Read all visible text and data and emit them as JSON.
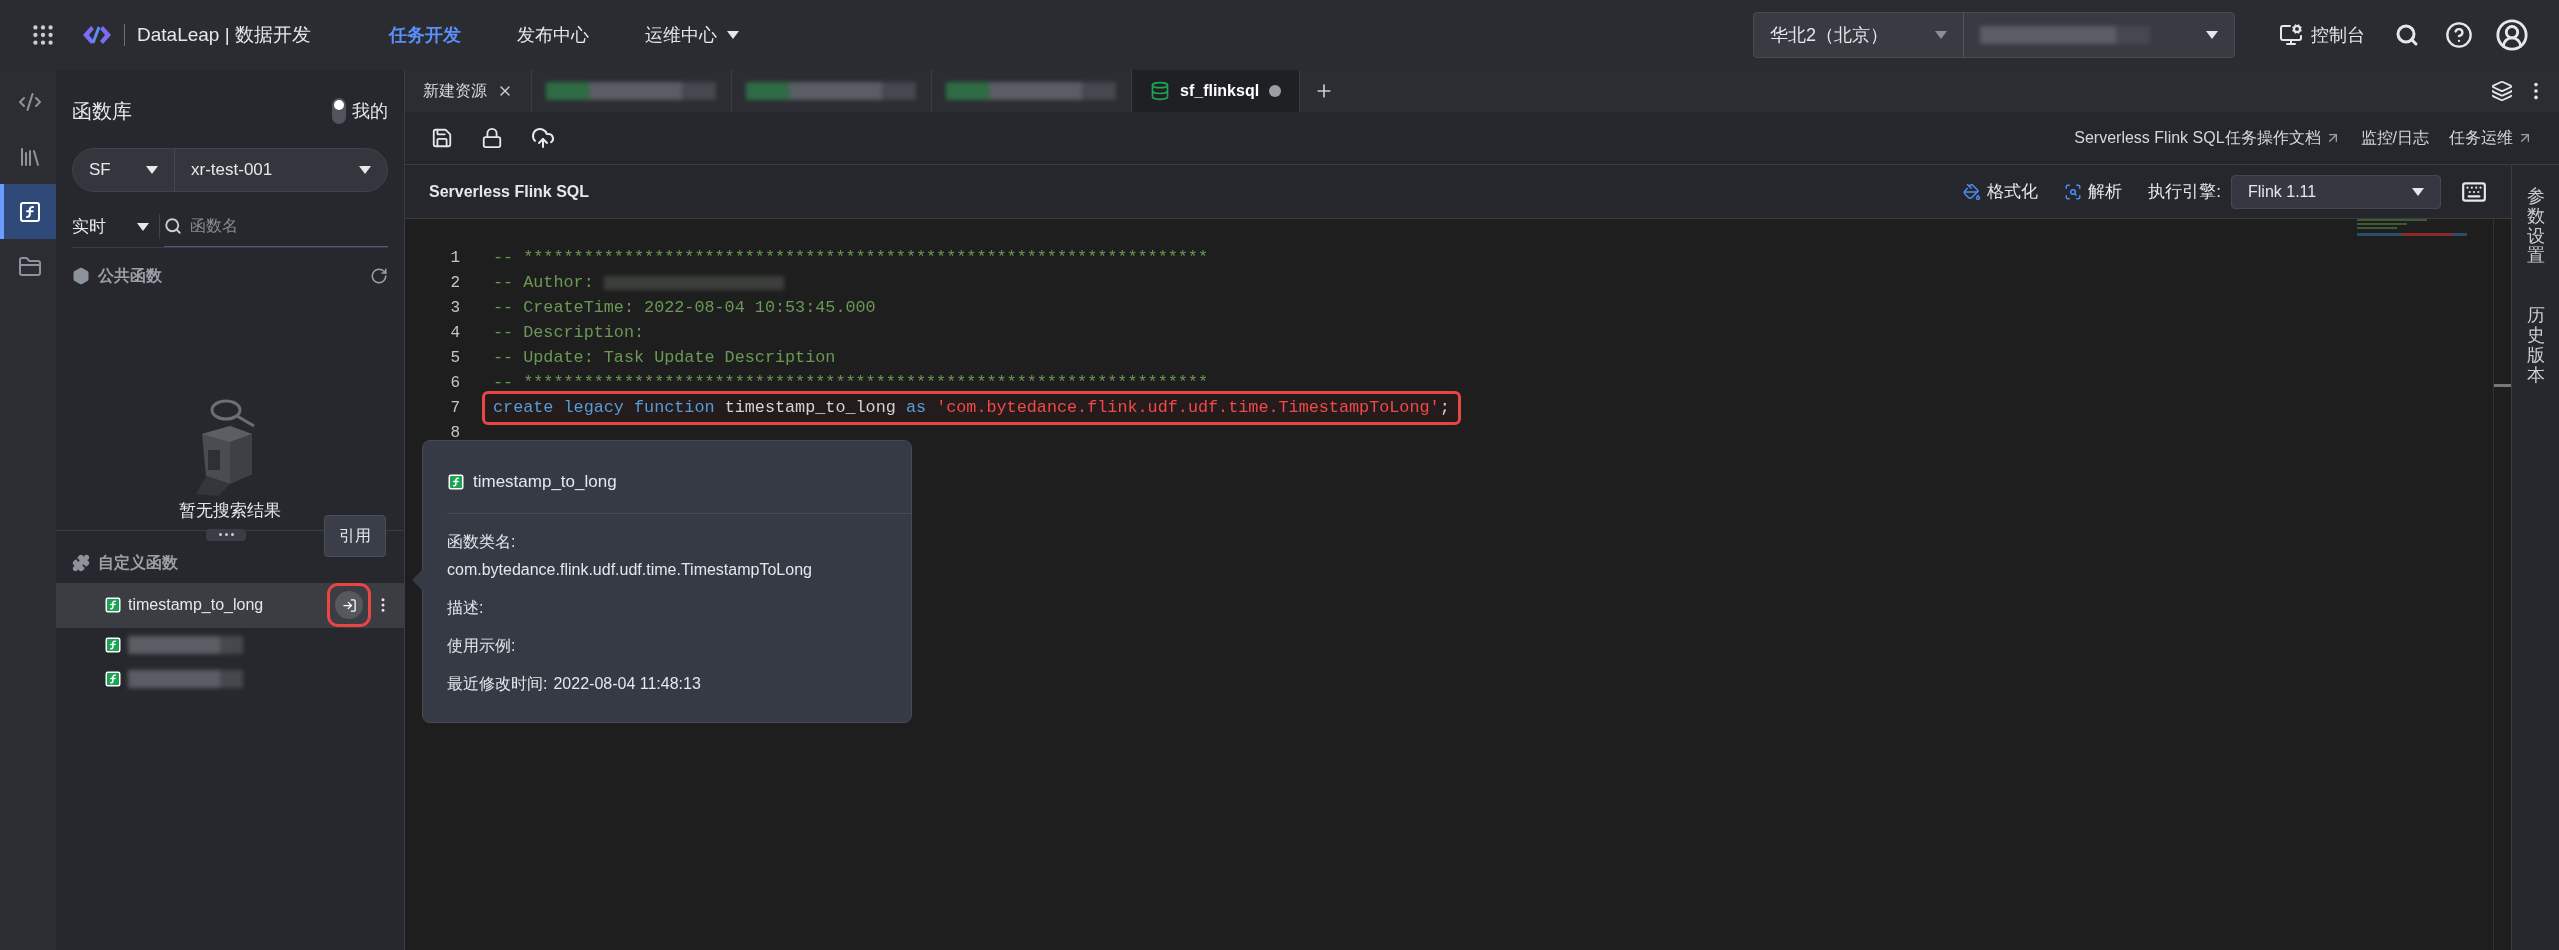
{
  "topbar": {
    "brand": "DataLeap | 数据开发",
    "nav": [
      {
        "label": "任务开发",
        "selected": true,
        "caret": false
      },
      {
        "label": "发布中心",
        "selected": false,
        "caret": false
      },
      {
        "label": "运维中心",
        "selected": false,
        "caret": true
      }
    ],
    "region": "华北2（北京）",
    "project": {
      "kind": "redacted"
    },
    "console": "控制台"
  },
  "rail": [
    {
      "kind": "code",
      "selected": false
    },
    {
      "kind": "library",
      "selected": false
    },
    {
      "kind": "function",
      "selected": true
    },
    {
      "kind": "drive",
      "selected": false
    }
  ],
  "panel": {
    "title": "函数库",
    "mine": {
      "label": "我的",
      "on": false
    },
    "engine": "SF",
    "project": "xr-test-001",
    "mode": "实时",
    "search_placeholder": "函数名",
    "public": {
      "title": "公共函数",
      "empty": "暂无搜索结果"
    },
    "custom": {
      "title": "自定义函数",
      "items": [
        {
          "kind": "named",
          "name": "timestamp_to_long",
          "selected": true
        },
        {
          "kind": "redacted",
          "selected": false
        },
        {
          "kind": "redacted",
          "selected": false
        }
      ]
    },
    "reference_tip": "引用"
  },
  "tabs": [
    {
      "kind": "named",
      "label": "新建资源",
      "selected": false,
      "closable": true
    },
    {
      "kind": "redacted",
      "selected": false
    },
    {
      "kind": "redacted",
      "selected": false
    },
    {
      "kind": "redacted",
      "selected": false
    },
    {
      "kind": "named",
      "label": "sf_flinksql",
      "selected": true,
      "closable": false
    }
  ],
  "links": [
    {
      "label": "Serverless Flink SQL任务操作文档",
      "external": true
    },
    {
      "label": "监控/日志",
      "external": false
    },
    {
      "label": "任务运维",
      "external": true
    }
  ],
  "editor": {
    "title": "Serverless Flink SQL",
    "format": "格式化",
    "parse": "解析",
    "engine_label": "执行引擎:",
    "engine": "Flink 1.11",
    "lines": [
      {
        "number": "1",
        "highlighted": false,
        "tokens": [
          {
            "kind": "comment",
            "text": "-- ********************************************************************"
          }
        ]
      },
      {
        "number": "2",
        "highlighted": false,
        "tokens": [
          {
            "kind": "comment",
            "text": "-- Author: "
          },
          {
            "kind": "redacted"
          }
        ]
      },
      {
        "number": "3",
        "highlighted": false,
        "tokens": [
          {
            "kind": "comment",
            "text": "-- CreateTime: 2022-08-04 10:53:45.000"
          }
        ]
      },
      {
        "number": "4",
        "highlighted": false,
        "tokens": [
          {
            "kind": "comment",
            "text": "-- Description:"
          }
        ]
      },
      {
        "number": "5",
        "highlighted": false,
        "tokens": [
          {
            "kind": "comment",
            "text": "-- Update: Task Update Description"
          }
        ]
      },
      {
        "number": "6",
        "highlighted": false,
        "tokens": [
          {
            "kind": "comment",
            "text": "-- ********************************************************************"
          }
        ]
      },
      {
        "number": "7",
        "highlighted": true,
        "tokens": [
          {
            "kind": "keyword",
            "text": "create legacy function "
          },
          {
            "kind": "plain",
            "text": "timestamp_to_long "
          },
          {
            "kind": "keyword",
            "text": "as "
          },
          {
            "kind": "string",
            "text": "'com.bytedance.flink.udf.udf.time.TimestampToLong'"
          },
          {
            "kind": "plain",
            "text": ";"
          }
        ]
      },
      {
        "number": "8",
        "highlighted": false
      }
    ]
  },
  "tooltip": {
    "title": "timestamp_to_long",
    "fields": [
      {
        "kind": "block",
        "label": "函数类名:",
        "value": "com.bytedance.flink.udf.udf.time.TimestampToLong"
      },
      {
        "kind": "block",
        "label": "描述:"
      },
      {
        "kind": "block",
        "label": "使用示例:"
      },
      {
        "kind": "inline",
        "label": "最近修改时间:",
        "value": "2022-08-04 11:48:13"
      }
    ]
  },
  "side_tabs": [
    "参数设置",
    "历史版本"
  ]
}
